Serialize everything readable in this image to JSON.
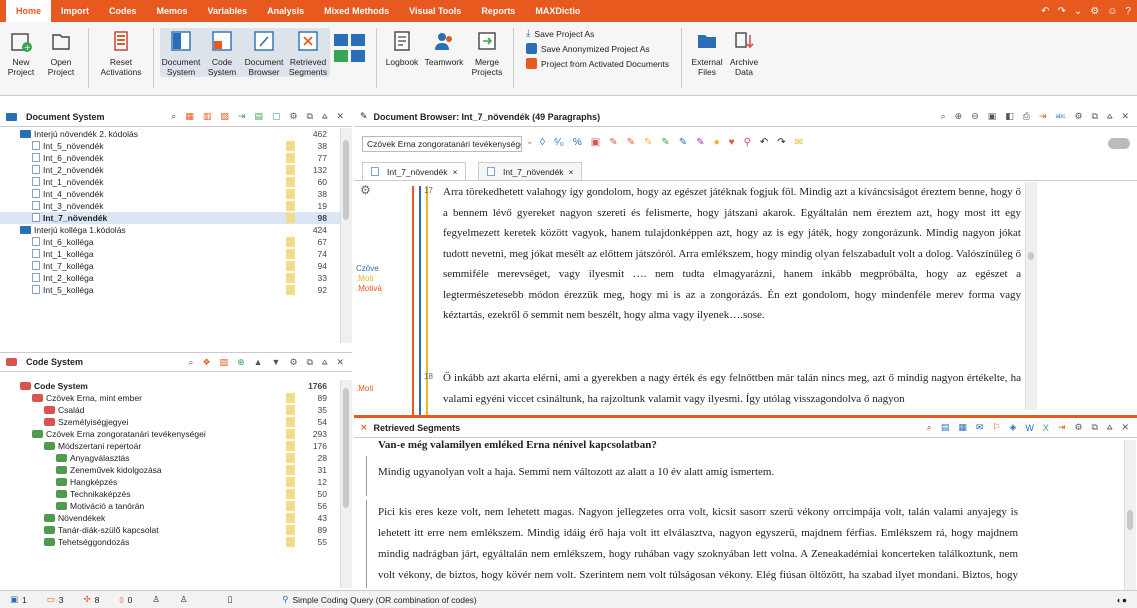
{
  "menu": {
    "items": [
      "Home",
      "Import",
      "Codes",
      "Memos",
      "Variables",
      "Analysis",
      "Mixed Methods",
      "Visual Tools",
      "Reports",
      "MAXDictio"
    ]
  },
  "ribbon": {
    "new": "New Project",
    "open": "Open Project",
    "reset": "Reset Activations",
    "document_system": "Document System",
    "code_system": "Code System",
    "document_browser": "Document Browser",
    "retrieved_segments": "Retrieved Segments",
    "logbook": "Logbook",
    "teamwork": "Teamwork",
    "merge": "Merge Projects",
    "save_as": "Save Project As",
    "save_anon": "Save Anonymized Project As",
    "project_from": "Project from Activated Documents",
    "external": "External Files",
    "archive": "Archive Data"
  },
  "doc_system": {
    "title": "Document System",
    "rows": [
      {
        "label": "Interjú növendék 2. kódolás",
        "count": "462",
        "type": "folder",
        "indent": 0
      },
      {
        "label": "Int_5_növendék",
        "count": "38",
        "type": "doc",
        "indent": 1
      },
      {
        "label": "Int_6_növendék",
        "count": "77",
        "type": "doc",
        "indent": 1
      },
      {
        "label": "Int_2_növendék",
        "count": "132",
        "type": "doc",
        "indent": 1
      },
      {
        "label": "Int_1_növendék",
        "count": "60",
        "type": "doc",
        "indent": 1
      },
      {
        "label": "Int_4_növendék",
        "count": "38",
        "type": "doc",
        "indent": 1
      },
      {
        "label": "Int_3_növendék",
        "count": "19",
        "type": "doc",
        "indent": 1
      },
      {
        "label": "Int_7_növendék",
        "count": "98",
        "type": "doc",
        "indent": 1,
        "bold": true,
        "sel": true
      },
      {
        "label": "Interjú kolléga 1.kódolás",
        "count": "424",
        "type": "folder",
        "indent": 0
      },
      {
        "label": "Int_6_kolléga",
        "count": "67",
        "type": "doc",
        "indent": 1
      },
      {
        "label": "Int_1_kolléga",
        "count": "74",
        "type": "doc",
        "indent": 1
      },
      {
        "label": "Int_7_kolléga",
        "count": "94",
        "type": "doc",
        "indent": 1
      },
      {
        "label": "Int_2_kolléga",
        "count": "33",
        "type": "doc",
        "indent": 1
      },
      {
        "label": "Int_5_kolléga",
        "count": "92",
        "type": "doc",
        "indent": 1
      }
    ]
  },
  "code_system": {
    "title": "Code System",
    "rows": [
      {
        "label": "Code System",
        "count": "1766",
        "indent": 0,
        "bold": true,
        "type": "root"
      },
      {
        "label": "Czövek Erna, mint ember",
        "count": "89",
        "indent": 1,
        "type": "red"
      },
      {
        "label": "Család",
        "count": "35",
        "indent": 2,
        "type": "red"
      },
      {
        "label": "Személyiségjegyei",
        "count": "54",
        "indent": 2,
        "type": "red"
      },
      {
        "label": "Czövek Erna zongoratanári tevékenységei",
        "count": "293",
        "indent": 1,
        "type": "code"
      },
      {
        "label": "Módszertani repertoár",
        "count": "176",
        "indent": 2,
        "type": "code"
      },
      {
        "label": "Anyagválasztás",
        "count": "28",
        "indent": 3,
        "type": "code"
      },
      {
        "label": "Zeneművek kidolgozása",
        "count": "31",
        "indent": 3,
        "type": "code"
      },
      {
        "label": "Hangképzés",
        "count": "12",
        "indent": 3,
        "type": "code"
      },
      {
        "label": "Technikaképzés",
        "count": "50",
        "indent": 3,
        "type": "code"
      },
      {
        "label": "Motiváció a tanórán",
        "count": "56",
        "indent": 3,
        "type": "code"
      },
      {
        "label": "Növendékek",
        "count": "43",
        "indent": 2,
        "type": "code"
      },
      {
        "label": "Tanár-diák-szülő kapcsolat",
        "count": "89",
        "indent": 2,
        "type": "code"
      },
      {
        "label": "Tehetséggondozás",
        "count": "55",
        "indent": 2,
        "type": "code"
      }
    ]
  },
  "browser": {
    "title": "Document Browser: Int_7_növendék  (49 Paragraphs)",
    "dropdown": "Czövek Erna zongoratanári tevékenységei",
    "tab1": "Int_7_növendék",
    "tab2": "Int_7_növendék",
    "para17_no": "17",
    "para17": "Arra törekedhetett valahogy így gondolom, hogy az egészet játéknak fogjuk föl. Mindig azt a kíváncsiságot éreztem benne, hogy ő a bennem lévő gyereket nagyon szereti és felismerte, hogy játszani akarok. Egyáltalán nem éreztem azt, hogy most itt egy fegyelmezett keretek között vagyok, hanem tulajdonképpen azt, hogy az is egy játék, hogy zongorázunk. Mindig nagyon jókat tudott nevetni, meg jókat mesélt az előttem játszóról. Arra emlékszem, hogy mindig olyan felszabadult volt a dolog. Valószínűleg ő semmiféle merevséget, vagy ilyesmit …. nem tudta elmagyarázni, hanem inkább megpróbálta, hogy az egészet a legtermészetesebb módon érezzük meg, hogy mi is az a zongorázás. Én ezt gondolom, hogy mindenféle merev forma vagy kéztartás, ezekről ő semmit nem beszélt, hogy alma vagy ilyenek….sose.",
    "para18_no": "18",
    "para18": "Ő inkább azt akarta elérni, ami a gyerekben a nagy érték és egy felnőttben már talán nincs meg, azt ő mindig nagyon értékelte, ha valami egyéni viccet csináltunk, ha rajzoltunk valamit vagy ilyesmi. Így utólag visszagondolva ő nagyon",
    "margin_code1": "Czöve",
    "margin_code2": ".Moti",
    "margin_code3": ".Motivá",
    "margin_code4": ".Moti"
  },
  "retrieved": {
    "title": "Retrieved Segments",
    "heading": "Van-e még valamilyen emléked Erna nénivel kapcsolatban?",
    "seg1": "Mindig ugyanolyan volt a haja. Semmi nem változott az alatt a 10 év alatt amíg ismertem.",
    "seg2": "Pici kis eres keze volt, nem lehetett magas. Nagyon jellegzetes orra volt, kicsit sasorr szerű vékony orrcimpája volt, talán valami anyajegy is lehetett itt erre nem emlékszem. Mindig idáig érő haja volt itt elválasztva, nagyon egyszerű, majdnem férfias. Emlékszem rá, hogy majdnem mindig nadrágban járt, egyáltalán nem emlékszem, hogy ruhában vagy szoknyában lett volna. A Zeneakadémiai koncerteken találkoztunk, nem volt vékony, de biztos, hogy kövér nem volt. Szerintem nem volt túlságosan vékony. Elég fiúsan öltözött, ha szabad ilyet mondani. Biztos, hogy nem sminkelte magát soha, hanem nagyon"
  },
  "status": {
    "docs": "1",
    "codes": "3",
    "memos": "8",
    "segs": "0",
    "query": "Simple Coding Query (OR combination of codes)"
  }
}
